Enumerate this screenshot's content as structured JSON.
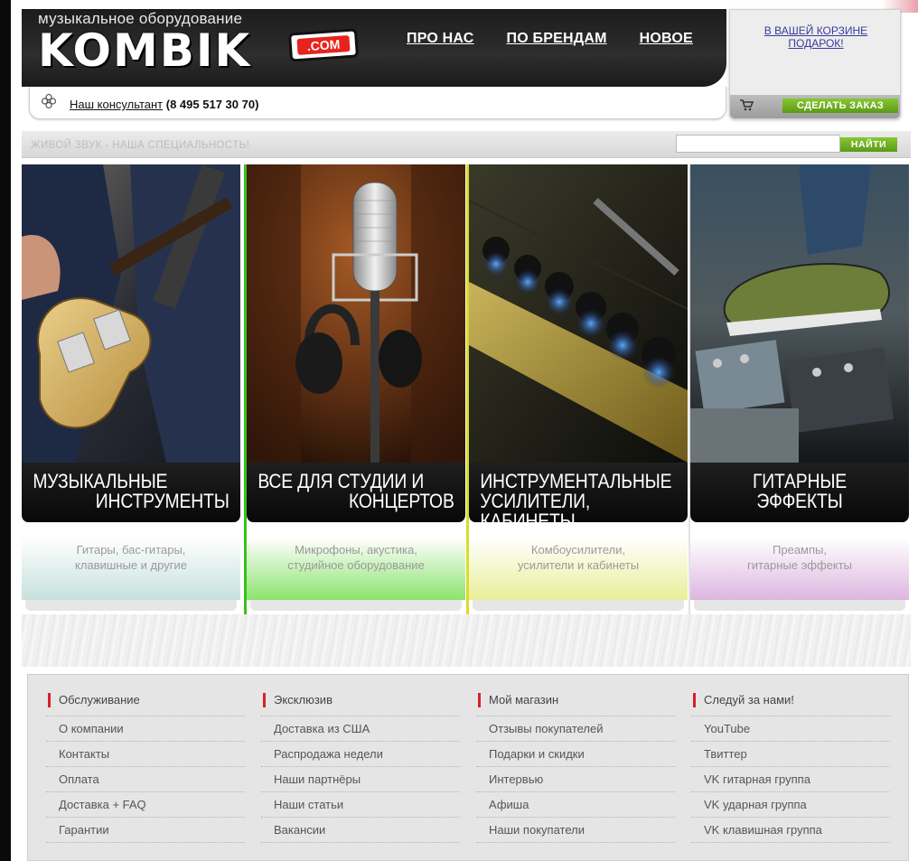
{
  "header": {
    "logo_tagline": "музыкальное оборудование",
    "logo_text": "KOMBIK",
    "logo_domain": ".COM",
    "nav": [
      {
        "label": "ПРО НАС"
      },
      {
        "label": "ПО БРЕНДАМ"
      },
      {
        "label": "НОВОЕ"
      }
    ]
  },
  "cart": {
    "gift_text": "В ВАШЕЙ КОРЗИНЕ ПОДАРОК!",
    "order_label": "СДЕЛАТЬ ЗАКАЗ",
    "cart_icon": "shopping-cart-icon"
  },
  "consultant": {
    "icon": "flower-icon",
    "link_text": "Наш консультант",
    "phone": "(8 495 517 30 70)"
  },
  "slogan": "ЖИВОЙ ЗВУК - НАША СПЕЦИАЛЬНОСТЬ!",
  "search": {
    "placeholder": "",
    "button_label": "НАЙТИ"
  },
  "categories": [
    {
      "title_line1": "МУЗЫКАЛЬНЫЕ",
      "title_line2": "ИНСТРУМЕНТЫ",
      "desc_line1": "Гитары, бас-гитары,",
      "desc_line2": "клавишные и другие",
      "accent": "#c6e1dc"
    },
    {
      "title_line1": "ВСЕ ДЛЯ СТУДИИ И",
      "title_line2": "КОНЦЕРТОВ",
      "desc_line1": "Микрофоны, акустика,",
      "desc_line2": "студийное оборудование",
      "accent": "#8be36c"
    },
    {
      "title_line1": "ИНСТРУМЕНТАЛЬНЫЕ",
      "title_line2": "УСИЛИТЕЛИ, КАБИНЕТЫ",
      "desc_line1": "Комбоусилители,",
      "desc_line2": "усилители и кабинеты",
      "accent": "#eaee98"
    },
    {
      "title_line1": "ГИТАРНЫЕ",
      "title_line2": "ЭФФЕКТЫ",
      "desc_line1": "Преампы,",
      "desc_line2": "гитарные эффекты",
      "accent": "#dcb6df"
    }
  ],
  "footer": {
    "columns": [
      {
        "head": "Обслуживание",
        "links": [
          "О компании",
          "Контакты",
          "Оплата",
          "Доставка + FAQ",
          "Гарантии"
        ]
      },
      {
        "head": "Эксклюзив",
        "links": [
          "Доставка из США",
          "Распродажа недели",
          "Наши партнёры",
          "Наши статьи",
          "Вакансии"
        ]
      },
      {
        "head": "Мой магазин",
        "links": [
          "Отзывы покупателей",
          "Подарки и скидки",
          "Интервью",
          "Афиша",
          "Наши покупатели"
        ]
      },
      {
        "head": "Следуй за нами!",
        "links": [
          "YouTube",
          "Твиттер",
          "VK гитарная группа",
          "VK ударная группа",
          "VK клавишная группа"
        ]
      }
    ]
  }
}
